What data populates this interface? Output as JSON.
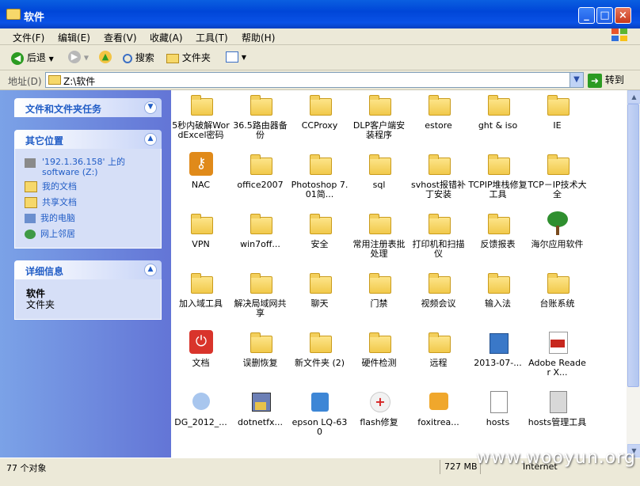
{
  "window": {
    "title": "软件",
    "min": "_",
    "max": "□",
    "close": "×"
  },
  "menu": [
    "文件(F)",
    "编辑(E)",
    "查看(V)",
    "收藏(A)",
    "工具(T)",
    "帮助(H)"
  ],
  "toolbar": {
    "back": "后退",
    "search": "搜索",
    "folders": "文件夹"
  },
  "address": {
    "label": "地址(D)",
    "value": "Z:\\软件",
    "go": "转到"
  },
  "tasks": {
    "file_tasks": {
      "title": "文件和文件夹任务"
    },
    "other_places": {
      "title": "其它位置",
      "items": [
        "'192.1.36.158' 上的 software (Z:)",
        "我的文档",
        "共享文档",
        "我的电脑",
        "网上邻居"
      ]
    },
    "details": {
      "title": "详细信息",
      "name": "软件",
      "type": "文件夹"
    }
  },
  "files": [
    {
      "name": "5秒内破解WordExcel密码",
      "icon": "folder"
    },
    {
      "name": "36.5路由器备份",
      "icon": "folder"
    },
    {
      "name": "CCProxy",
      "icon": "folder"
    },
    {
      "name": "DLP客户端安装程序",
      "icon": "folder"
    },
    {
      "name": "estore",
      "icon": "folder"
    },
    {
      "name": "ght & iso",
      "icon": "folder"
    },
    {
      "name": "IE",
      "icon": "folder"
    },
    {
      "name": "NAC",
      "icon": "key-app"
    },
    {
      "name": "office2007",
      "icon": "folder"
    },
    {
      "name": "Photoshop 7.01简...",
      "icon": "folder"
    },
    {
      "name": "sql",
      "icon": "folder"
    },
    {
      "name": "svhost报错补丁安装",
      "icon": "folder"
    },
    {
      "name": "TCPIP堆栈修复工具",
      "icon": "folder"
    },
    {
      "name": "TCP－IP技术大全",
      "icon": "folder"
    },
    {
      "name": "VPN",
      "icon": "folder"
    },
    {
      "name": "win7off...",
      "icon": "folder"
    },
    {
      "name": "安全",
      "icon": "folder"
    },
    {
      "name": "常用注册表批处理",
      "icon": "folder"
    },
    {
      "name": "打印机和扫描仪",
      "icon": "folder"
    },
    {
      "name": "反馈报表",
      "icon": "folder"
    },
    {
      "name": "海尔应用软件",
      "icon": "tree"
    },
    {
      "name": "加入域工具",
      "icon": "folder"
    },
    {
      "name": "解决局域网共享",
      "icon": "folder"
    },
    {
      "name": "聊天",
      "icon": "folder"
    },
    {
      "name": "门禁",
      "icon": "folder"
    },
    {
      "name": "视频会议",
      "icon": "folder"
    },
    {
      "name": "输入法",
      "icon": "folder"
    },
    {
      "name": "台账系统",
      "icon": "folder"
    },
    {
      "name": "文档",
      "icon": "power-app"
    },
    {
      "name": "误删恢复",
      "icon": "folder"
    },
    {
      "name": "新文件夹 (2)",
      "icon": "folder"
    },
    {
      "name": "硬件检测",
      "icon": "folder"
    },
    {
      "name": "远程",
      "icon": "folder"
    },
    {
      "name": "2013-07-...",
      "icon": "installer"
    },
    {
      "name": "Adobe Reader X...",
      "icon": "pdf-app"
    },
    {
      "name": "DG_2012_...",
      "icon": "mascot"
    },
    {
      "name": "dotnetfx...",
      "icon": "setup-box"
    },
    {
      "name": "epson LQ-630",
      "icon": "printer-app"
    },
    {
      "name": "flash修复",
      "icon": "medic"
    },
    {
      "name": "foxitrea...",
      "icon": "foxit"
    },
    {
      "name": "hosts",
      "icon": "text-file"
    },
    {
      "name": "hosts管理工具",
      "icon": "calculator"
    }
  ],
  "status": {
    "count": "77 个对象",
    "size": "727 MB",
    "zone": "Internet"
  },
  "watermark": "www.wooyun.org"
}
